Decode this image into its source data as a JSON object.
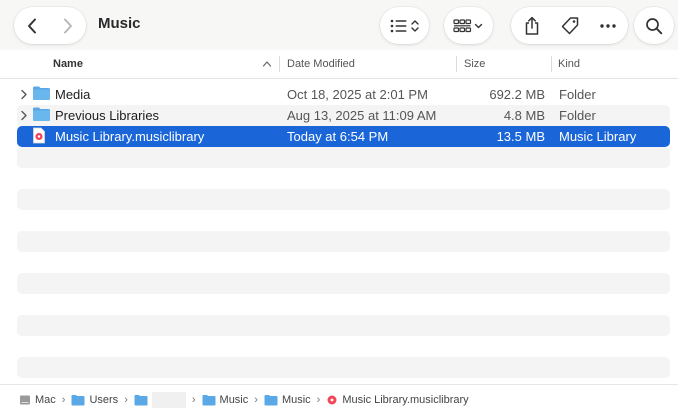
{
  "window": {
    "title": "Music"
  },
  "toolbar": {
    "back_icon": "chevron-left-icon",
    "forward_icon": "chevron-right-icon",
    "view_list_icon": "list-view-icon",
    "view_grid_icon": "grid-view-icon",
    "share_icon": "share-icon",
    "tag_icon": "tag-icon",
    "more_icon": "ellipsis-icon",
    "search_icon": "search-icon"
  },
  "columns": {
    "name": "Name",
    "date": "Date Modified",
    "size": "Size",
    "kind": "Kind"
  },
  "files": [
    {
      "name": "Media",
      "date": "Oct 18, 2025 at 2:01 PM",
      "size": "692.2 MB",
      "kind": "Folder",
      "icon": "folder-icon",
      "expandable": true,
      "selected": false
    },
    {
      "name": "Previous Libraries",
      "date": "Aug 13, 2025 at 11:09 AM",
      "size": "4.8 MB",
      "kind": "Folder",
      "icon": "folder-icon",
      "expandable": true,
      "selected": false
    },
    {
      "name": "Music Library.musiclibrary",
      "date": "Today at 6:54 PM",
      "size": "13.5 MB",
      "kind": "Music Library",
      "icon": "music-library-icon",
      "expandable": false,
      "selected": true
    }
  ],
  "pathbar": {
    "items": [
      {
        "label": "Mac",
        "icon": "disk-icon"
      },
      {
        "label": "Users",
        "icon": "folder-icon"
      },
      {
        "label": "",
        "icon": "folder-icon"
      },
      {
        "label": "Music",
        "icon": "folder-icon"
      },
      {
        "label": "Music",
        "icon": "folder-icon"
      },
      {
        "label": "Music Library.musiclibrary",
        "icon": "music-library-icon"
      }
    ]
  },
  "colors": {
    "selection": "#1a66d8",
    "folder": "#5aa9e6",
    "stripe": "#f4f4f4"
  }
}
